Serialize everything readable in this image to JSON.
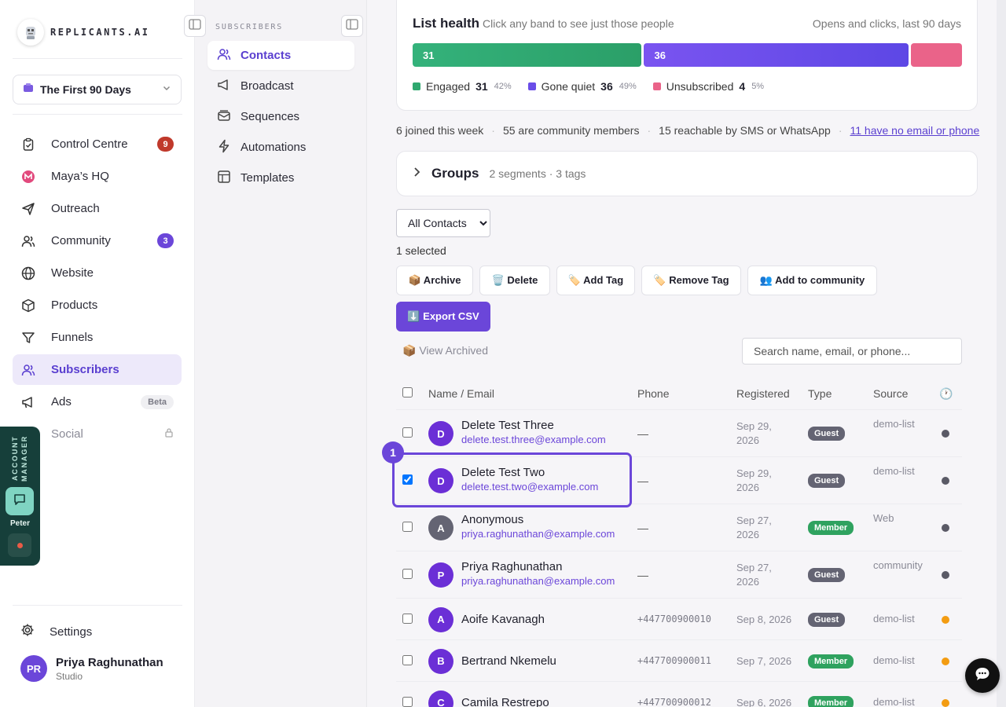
{
  "brand": {
    "name": "REPLICANTS.AI"
  },
  "workspace": {
    "name": "The First 90 Days"
  },
  "nav": [
    {
      "label": "Control Centre",
      "icon": "clipboard-icon",
      "badge": "9",
      "badge_color": "#c0392b"
    },
    {
      "label": "Maya’s HQ",
      "icon": "maya-logo-icon"
    },
    {
      "label": "Outreach",
      "icon": "send-icon"
    },
    {
      "label": "Community",
      "icon": "users-icon",
      "badge": "3",
      "badge_color": "#6b46d9"
    },
    {
      "label": "Website",
      "icon": "globe-icon"
    },
    {
      "label": "Products",
      "icon": "box-icon"
    },
    {
      "label": "Funnels",
      "icon": "funnel-icon"
    },
    {
      "label": "Subscribers",
      "icon": "subscribers-icon",
      "active": true
    },
    {
      "label": "Ads",
      "icon": "megaphone-icon",
      "badge": "Beta"
    },
    {
      "label": "Social",
      "icon": "social-icon",
      "locked": true
    }
  ],
  "settings_label": "Settings",
  "user": {
    "initials": "PR",
    "name": "Priya Raghunathan",
    "plan": "Studio"
  },
  "account_manager": {
    "label": "ACCOUNT MANAGER",
    "name": "Peter"
  },
  "subnav": {
    "heading": "SUBSCRIBERS",
    "items": [
      {
        "label": "Contacts",
        "active": true
      },
      {
        "label": "Broadcast"
      },
      {
        "label": "Sequences"
      },
      {
        "label": "Automations"
      },
      {
        "label": "Templates"
      }
    ]
  },
  "health": {
    "title": "List health",
    "hint": "Click any band to see just those people",
    "period": "Opens and clicks, last 90 days",
    "bands": [
      {
        "label": "Engaged",
        "count": "31",
        "pct": "42%",
        "color": "#2fa86f"
      },
      {
        "label": "Gone quiet",
        "count": "36",
        "pct": "49%",
        "color": "#6a4de8"
      },
      {
        "label": "Unsubscribed",
        "count": "4",
        "pct": "5%",
        "color": "#ea6389"
      }
    ]
  },
  "stats": {
    "joined": "6 joined this week",
    "community": "55 are community members",
    "reachable": "15 reachable by SMS or WhatsApp",
    "no_contact": "11 have no email or phone"
  },
  "groups": {
    "title": "Groups",
    "summary": "2 segments · 3 tags"
  },
  "filter": {
    "selected": "All Contacts"
  },
  "selection": {
    "text": "1 selected"
  },
  "actions": {
    "archive": "📦 Archive",
    "delete": "🗑️ Delete",
    "add_tag": "🏷️ Add Tag",
    "remove_tag": "🏷️ Remove Tag",
    "add_community": "👥 Add to community",
    "export": "⬇️ Export CSV"
  },
  "view_archived": "📦 View Archived",
  "search": {
    "placeholder": "Search name, email, or phone..."
  },
  "table": {
    "columns": {
      "name": "Name / Email",
      "phone": "Phone",
      "registered": "Registered",
      "type": "Type",
      "source": "Source",
      "recent": "🕐"
    },
    "rows": [
      {
        "initial": "D",
        "avatar_color": "#6b2fd6",
        "name": "Delete Test Three",
        "email": "delete.test.three@example.com",
        "phone": "—",
        "registered": [
          "Sep 29,",
          "2026"
        ],
        "type": "Guest",
        "source": "demo-list",
        "status_color": "#5a5a66",
        "checked": false
      },
      {
        "initial": "D",
        "avatar_color": "#6b2fd6",
        "name": "Delete Test Two",
        "email": "delete.test.two@example.com",
        "phone": "—",
        "registered": [
          "Sep 29,",
          "2026"
        ],
        "type": "Guest",
        "source": "demo-list",
        "status_color": "#5a5a66",
        "checked": true
      },
      {
        "initial": "A",
        "avatar_color": "#646473",
        "name": "Anonymous",
        "email": "priya.raghunathan@example.com",
        "phone": "—",
        "registered": [
          "Sep 27,",
          "2026"
        ],
        "type": "Member",
        "source": "Web",
        "status_color": "#5a5a66",
        "checked": false
      },
      {
        "initial": "P",
        "avatar_color": "#6b2fd6",
        "name": "Priya Raghunathan",
        "email": "priya.raghunathan@example.com",
        "phone": "—",
        "registered": [
          "Sep 27,",
          "2026"
        ],
        "type": "Guest",
        "source": "community",
        "status_color": "#5a5a66",
        "checked": false
      },
      {
        "initial": "A",
        "avatar_color": "#6b2fd6",
        "name": "Aoife Kavanagh",
        "email": "",
        "phone": "+447700900010",
        "registered": [
          "Sep 8, 2026"
        ],
        "type": "Guest",
        "source": "demo-list",
        "status_color": "#f39c12",
        "checked": false
      },
      {
        "initial": "B",
        "avatar_color": "#6b2fd6",
        "name": "Bertrand Nkemelu",
        "email": "",
        "phone": "+447700900011",
        "registered": [
          "Sep 7, 2026"
        ],
        "type": "Member",
        "source": "demo-list",
        "status_color": "#f39c12",
        "checked": false
      },
      {
        "initial": "C",
        "avatar_color": "#6b2fd6",
        "name": "Camila Restrepo",
        "email": "",
        "phone": "+447700900012",
        "registered": [
          "Sep 6, 2026"
        ],
        "type": "Member",
        "source": "demo-list",
        "status_color": "#f39c12",
        "checked": false
      }
    ]
  },
  "highlight_badge": "1"
}
